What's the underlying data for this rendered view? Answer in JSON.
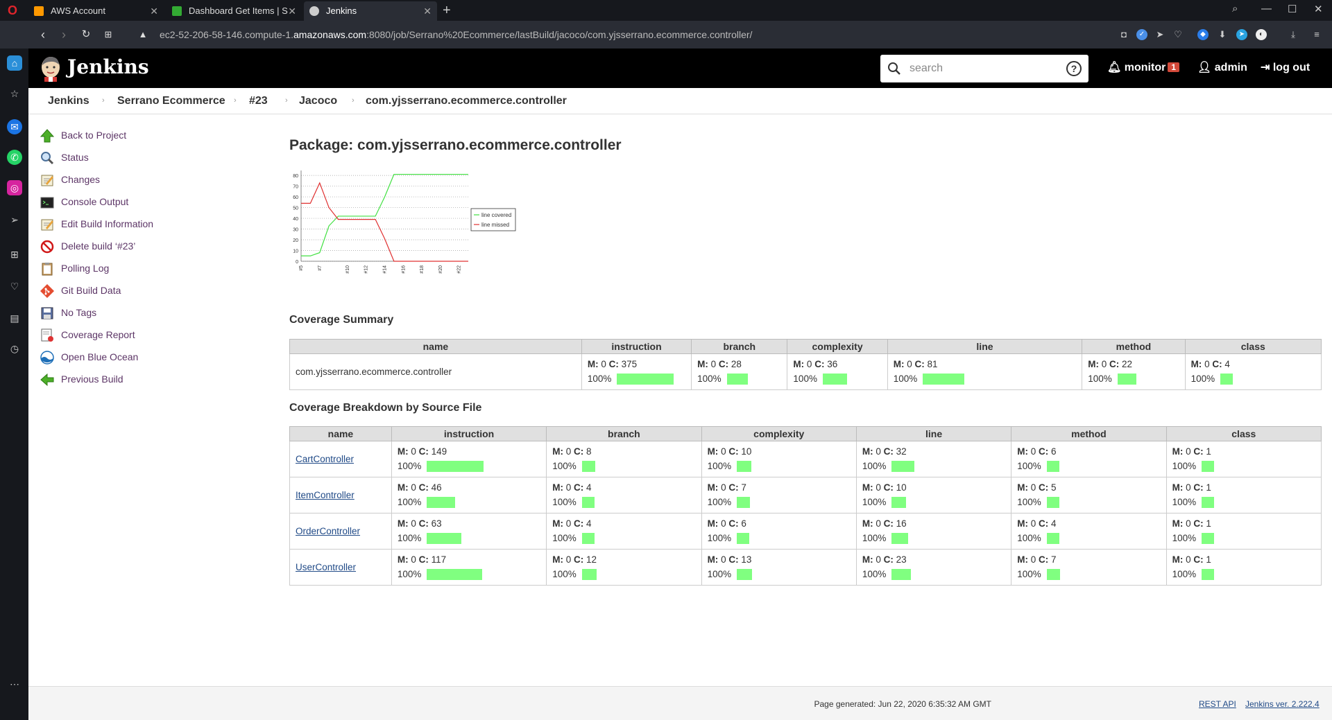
{
  "browser": {
    "tabs": [
      {
        "title": "AWS Account",
        "color": "#f90"
      },
      {
        "title": "Dashboard Get Items | S",
        "color": "#3a3"
      },
      {
        "title": "Jenkins",
        "color": "#ccc"
      }
    ],
    "url_prefix": "ec2-52-206-58-146.compute-1.",
    "url_domain": "amazonaws.com",
    "url_suffix": ":8080/job/Serrano%20Ecommerce/lastBuild/jacoco/com.yjsserrano.ecommerce.controller/"
  },
  "header": {
    "title": "Jenkins",
    "search_placeholder": "search",
    "help": "?",
    "monitor": "monitor",
    "monitor_count": "1",
    "user": "admin",
    "logout": "log out"
  },
  "breadcrumbs": [
    "Jenkins",
    "Serrano Ecommerce",
    "#23",
    "Jacoco",
    "com.yjsserrano.ecommerce.controller"
  ],
  "tasks": [
    {
      "label": "Back to Project",
      "icon": "up-arrow-icon"
    },
    {
      "label": "Status",
      "icon": "search-icon"
    },
    {
      "label": "Changes",
      "icon": "notepad-icon"
    },
    {
      "label": "Console Output",
      "icon": "terminal-icon"
    },
    {
      "label": "Edit Build Information",
      "icon": "notepad-icon"
    },
    {
      "label": "Delete build ‘#23’",
      "icon": "no-entry-icon"
    },
    {
      "label": "Polling Log",
      "icon": "clipboard-icon"
    },
    {
      "label": "Git Build Data",
      "icon": "git-icon"
    },
    {
      "label": "No Tags",
      "icon": "save-icon"
    },
    {
      "label": "Coverage Report",
      "icon": "report-icon"
    },
    {
      "label": "Open Blue Ocean",
      "icon": "blue-ocean-icon"
    },
    {
      "label": "Previous Build",
      "icon": "left-arrow-icon"
    }
  ],
  "main": {
    "title": "Package: com.yjsserrano.ecommerce.controller",
    "summary_title": "Coverage Summary",
    "breakdown_title": "Coverage Breakdown by Source File",
    "columns": [
      "name",
      "instruction",
      "branch",
      "complexity",
      "line",
      "method",
      "class"
    ],
    "summary_row": {
      "name": "com.yjsserrano.ecommerce.controller",
      "cells": [
        {
          "m": "0",
          "c": "375",
          "pct": "100%"
        },
        {
          "m": "0",
          "c": "28",
          "pct": "100%"
        },
        {
          "m": "0",
          "c": "36",
          "pct": "100%"
        },
        {
          "m": "0",
          "c": "81",
          "pct": "100%"
        },
        {
          "m": "0",
          "c": "22",
          "pct": "100%"
        },
        {
          "m": "0",
          "c": "4",
          "pct": "100%"
        }
      ]
    },
    "files": [
      {
        "name": "CartController",
        "cells": [
          {
            "m": "0",
            "c": "149",
            "pct": "100%"
          },
          {
            "m": "0",
            "c": "8",
            "pct": "100%"
          },
          {
            "m": "0",
            "c": "10",
            "pct": "100%"
          },
          {
            "m": "0",
            "c": "32",
            "pct": "100%"
          },
          {
            "m": "0",
            "c": "6",
            "pct": "100%"
          },
          {
            "m": "0",
            "c": "1",
            "pct": "100%"
          }
        ]
      },
      {
        "name": "ItemController",
        "cells": [
          {
            "m": "0",
            "c": "46",
            "pct": "100%"
          },
          {
            "m": "0",
            "c": "4",
            "pct": "100%"
          },
          {
            "m": "0",
            "c": "7",
            "pct": "100%"
          },
          {
            "m": "0",
            "c": "10",
            "pct": "100%"
          },
          {
            "m": "0",
            "c": "5",
            "pct": "100%"
          },
          {
            "m": "0",
            "c": "1",
            "pct": "100%"
          }
        ]
      },
      {
        "name": "OrderController",
        "cells": [
          {
            "m": "0",
            "c": "63",
            "pct": "100%"
          },
          {
            "m": "0",
            "c": "4",
            "pct": "100%"
          },
          {
            "m": "0",
            "c": "6",
            "pct": "100%"
          },
          {
            "m": "0",
            "c": "16",
            "pct": "100%"
          },
          {
            "m": "0",
            "c": "4",
            "pct": "100%"
          },
          {
            "m": "0",
            "c": "1",
            "pct": "100%"
          }
        ]
      },
      {
        "name": "UserController",
        "cells": [
          {
            "m": "0",
            "c": "117",
            "pct": "100%"
          },
          {
            "m": "0",
            "c": "12",
            "pct": "100%"
          },
          {
            "m": "0",
            "c": "13",
            "pct": "100%"
          },
          {
            "m": "0",
            "c": "23",
            "pct": "100%"
          },
          {
            "m": "0",
            "c": "7",
            "pct": "100%"
          },
          {
            "m": "0",
            "c": "1",
            "pct": "100%"
          }
        ]
      }
    ]
  },
  "chart_data": {
    "type": "line",
    "x": [
      "#5",
      "#6",
      "#7",
      "#8",
      "#9",
      "#10",
      "#11",
      "#12",
      "#13",
      "#14",
      "#15",
      "#16",
      "#17",
      "#18",
      "#19",
      "#20",
      "#21",
      "#22",
      "#23"
    ],
    "x_tick_labels": [
      "#5",
      "#7",
      "#10",
      "#12",
      "#14",
      "#16",
      "#18",
      "#20",
      "#22"
    ],
    "series": [
      {
        "name": "line covered",
        "color": "#40e040",
        "values": [
          5,
          5,
          8,
          33,
          42,
          42,
          42,
          42,
          42,
          60,
          81,
          81,
          81,
          81,
          81,
          81,
          81,
          81,
          81
        ]
      },
      {
        "name": "line missed",
        "color": "#e03030",
        "values": [
          54,
          54,
          73,
          50,
          39,
          39,
          39,
          39,
          39,
          21,
          0,
          0,
          0,
          0,
          0,
          0,
          0,
          0,
          0
        ]
      }
    ],
    "yticks": [
      0,
      10,
      20,
      30,
      40,
      50,
      60,
      70,
      80
    ],
    "ylim": [
      0,
      82
    ],
    "grid": true,
    "legend": "right"
  },
  "footer": {
    "generated": "Page generated: Jun 22, 2020 6:35:32 AM GMT",
    "rest_api": "REST API",
    "version": "Jenkins ver. 2.222.4"
  }
}
